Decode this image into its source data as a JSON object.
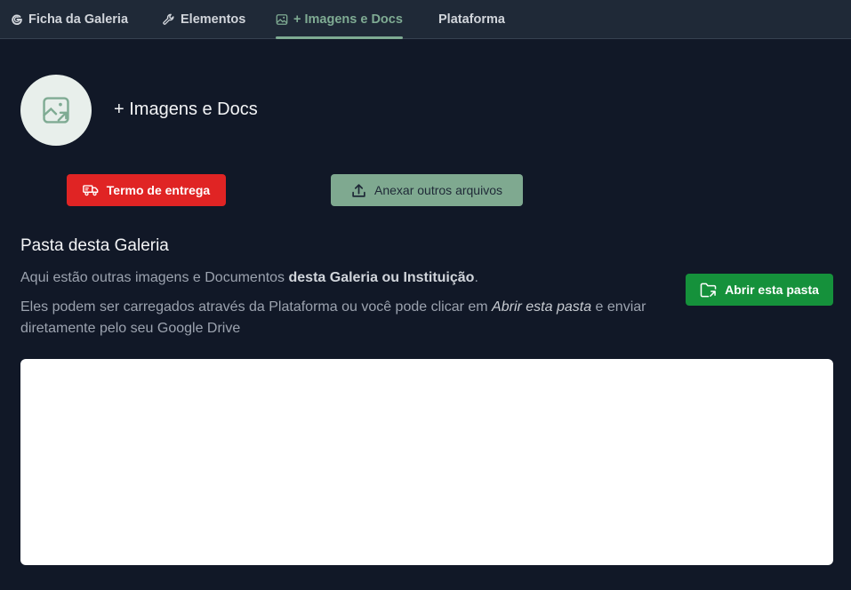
{
  "tabs": [
    {
      "label": "Ficha da Galeria",
      "icon": "gallery-g-icon",
      "active": false
    },
    {
      "label": "Elementos",
      "icon": "wrench-icon",
      "active": false
    },
    {
      "label": "+ Imagens e Docs",
      "icon": "image-icon",
      "active": true
    },
    {
      "label": "Plataforma",
      "icon": "",
      "active": false
    }
  ],
  "header": {
    "title": "+ Imagens e Docs",
    "avatar_icon": "image-arrow-icon"
  },
  "actions": {
    "termo_label": "Termo de entrega",
    "termo_icon": "truck-icon",
    "anexar_label": "Anexar outros arquivos",
    "anexar_icon": "upload-icon"
  },
  "folder": {
    "title": "Pasta desta Galeria",
    "desc1_prefix": "Aqui estão outras imagens e Documentos ",
    "desc1_bold": "desta Galeria ou Instituição",
    "desc1_suffix": ".",
    "desc2_prefix": "Eles podem ser carregados através da Plataforma ou você pode clicar em ",
    "desc2_italic": "Abrir esta pasta",
    "desc2_suffix": " e enviar diretamente pelo seu Google Drive",
    "open_label": "Abrir esta pasta",
    "open_icon": "folder-icon"
  },
  "colors": {
    "background": "#111827",
    "tabbar": "#1f2937",
    "accent": "#7fab93",
    "danger": "#e02424",
    "success": "#15913b"
  }
}
